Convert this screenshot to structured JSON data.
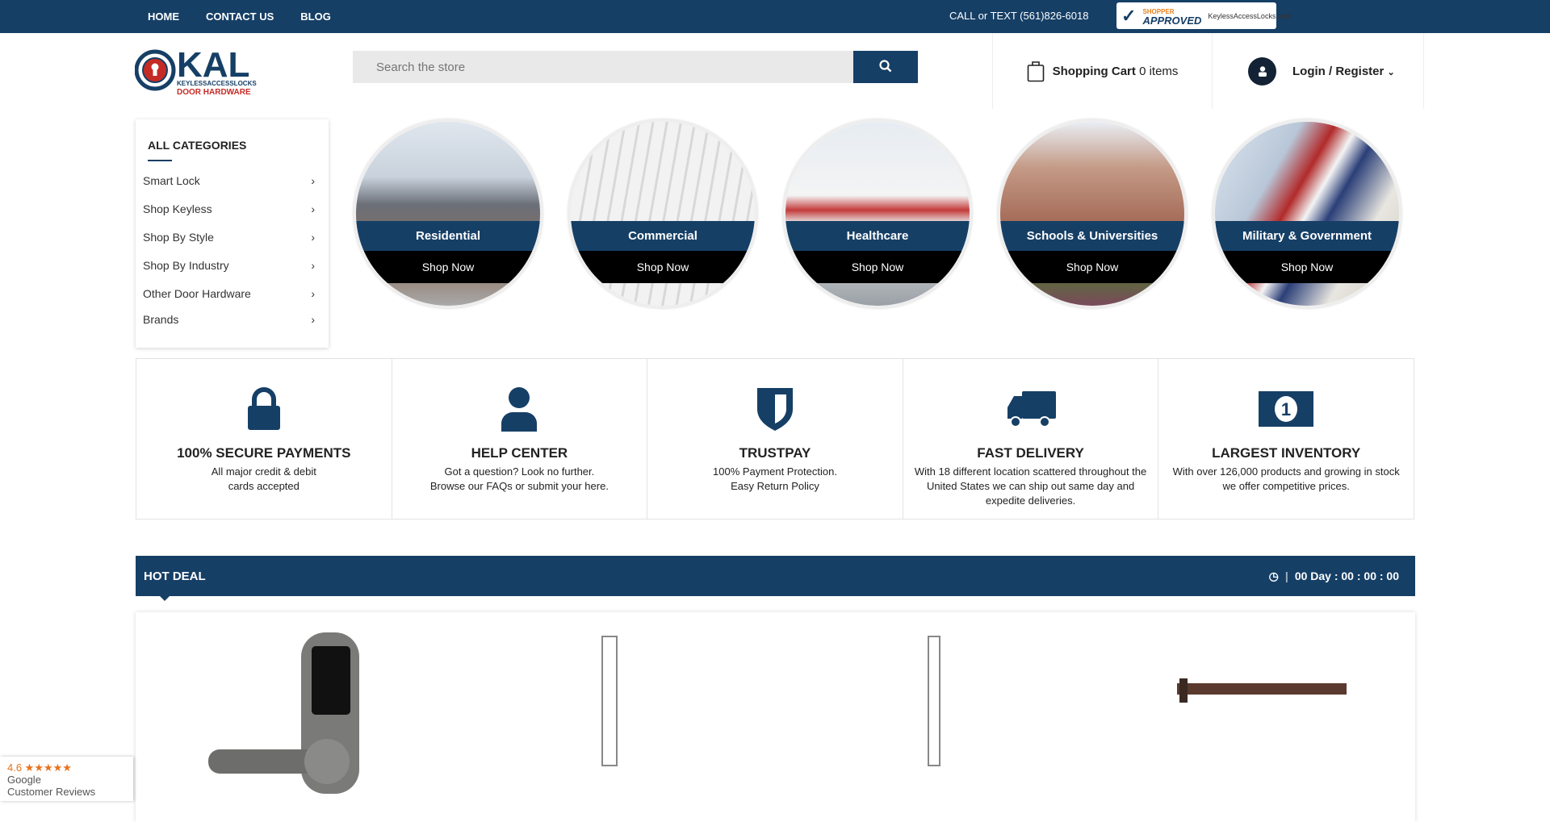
{
  "topbar": {
    "nav": [
      "HOME",
      "CONTACT US",
      "BLOG"
    ],
    "phone": "CALL or TEXT (561)826-6018",
    "badge": {
      "brand_top": "SHOPPER",
      "brand": "APPROVED",
      "domain": "KeylessAccessLocks.com"
    }
  },
  "logo": {
    "text": "KAL",
    "tagline1": "KEYLESSACCESSLOCKS",
    "tagline2": "DOOR HARDWARE"
  },
  "search": {
    "placeholder": "Search the store"
  },
  "cart": {
    "label": "Shopping Cart",
    "count": "0 items"
  },
  "login": {
    "label": "Login / Register"
  },
  "categories": {
    "title": "ALL CATEGORIES",
    "items": [
      "Smart Lock",
      "Shop Keyless",
      "Shop By Style",
      "Shop By Industry",
      "Other Door Hardware",
      "Brands"
    ]
  },
  "industries": [
    {
      "label": "Residential",
      "cta": "Shop Now"
    },
    {
      "label": "Commercial",
      "cta": "Shop Now"
    },
    {
      "label": "Healthcare",
      "cta": "Shop Now"
    },
    {
      "label": "Schools & Universities",
      "cta": "Shop Now"
    },
    {
      "label": "Military & Government",
      "cta": "Shop Now"
    }
  ],
  "features": [
    {
      "icon": "lock-icon",
      "title": "100% SECURE PAYMENTS",
      "line1": "All major credit & debit",
      "line2": "cards accepted"
    },
    {
      "icon": "user-icon",
      "title": "HELP CENTER",
      "line1": "Got a question? Look no further.",
      "line2": "Browse our FAQs or submit your here."
    },
    {
      "icon": "shield-icon",
      "title": "TRUSTPAY",
      "line1": "100% Payment Protection.",
      "line2": "Easy Return Policy"
    },
    {
      "icon": "truck-icon",
      "title": "FAST DELIVERY",
      "line1": "With 18 different location scattered throughout the United States we can ship out same day and expedite deliveries.",
      "line2": ""
    },
    {
      "icon": "money-icon",
      "title": "LARGEST INVENTORY",
      "line1": "With over 126,000 products and growing in stock we offer competitive prices.",
      "line2": ""
    }
  ],
  "hot_deal": {
    "title": "HOT DEAL",
    "timer": "00 Day : 00 : 00 : 00"
  },
  "google_reviews": {
    "rating": "4.6 ★★★★★",
    "brand": "Google",
    "label": "Customer Reviews"
  },
  "colors": {
    "primary": "#163f66",
    "black": "#000000"
  }
}
